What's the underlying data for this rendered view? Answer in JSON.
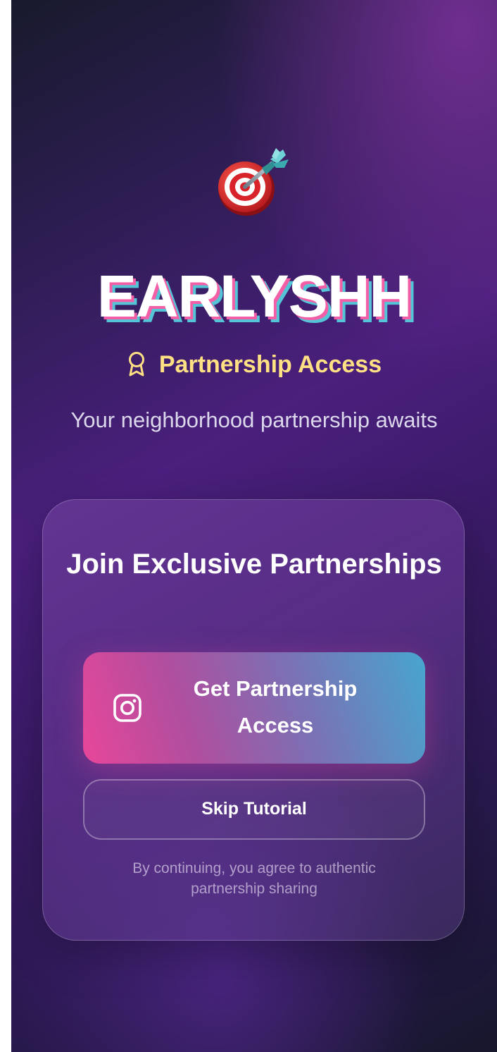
{
  "app": {
    "logo_icon": "dart-target-icon",
    "brand_name": "EARLYSHH",
    "badge_icon": "award-ribbon-icon",
    "badge_text": "Partnership Access",
    "tagline": "Your neighborhood partnership awaits"
  },
  "card": {
    "title": "Join Exclusive Partnerships",
    "primary_button": {
      "icon": "instagram-icon",
      "label": "Get Partnership Access"
    },
    "secondary_button": {
      "label": "Skip Tutorial"
    },
    "legal_text": "By continuing, you agree to authentic partnership sharing"
  },
  "colors": {
    "accent_yellow": "#ffe083",
    "brand_shadow_pink": "#f35fa6",
    "brand_shadow_cyan": "#54c4d7",
    "button_gradient_start": "#e8469a",
    "button_gradient_end": "#47a6cf",
    "background_purple": "#4a1f7d"
  }
}
